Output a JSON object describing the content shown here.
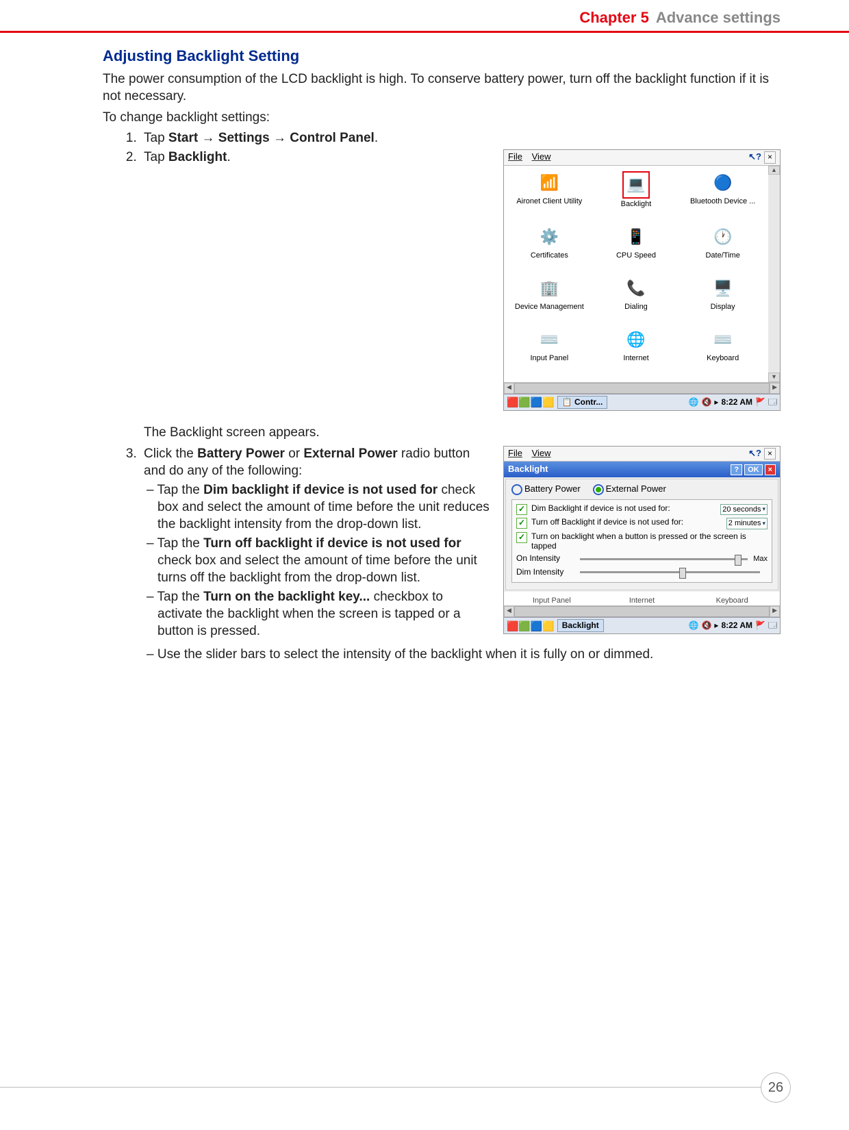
{
  "header": {
    "chapter": "Chapter 5",
    "title": "Advance settings"
  },
  "section_title": "Adjusting Backlight Setting",
  "intro1": "The power consumption of the LCD backlight is high. To conserve battery power, turn off the backlight function if it is not necessary.",
  "intro2": "To change backlight settings:",
  "step1_pre": "Tap ",
  "step1_b1": "Start",
  "step1_b2": "Settings",
  "step1_b3": "Control Panel",
  "arrow": " → ",
  "period": ".",
  "step2_pre": "Tap ",
  "step2_b": "Backlight",
  "appears": "The Backlight screen appears.",
  "step3_pre": "Click the ",
  "step3_b1": "Battery Power",
  "step3_mid": " or ",
  "step3_b2": "External Power",
  "step3_post": " radio button and do any of the fol­lowing:",
  "bul1_pre": "Tap the ",
  "bul1_b": "Dim backlight if device is not used for",
  "bul1_post": " check box and select the amount of time before the unit reduces the backlight intensity from the drop-down list.",
  "bul2_pre": "Tap the ",
  "bul2_b": "Turn off backlight if device is not used for",
  "bul2_post": " check box and select the amount of time before the unit turns off the backlight from the drop-down list.",
  "bul3_pre": "Tap the ",
  "bul3_b": "Turn on the backlight key...",
  "bul3_post": " checkbox to activate the backlight when the screen is tapped or a button is pressed.",
  "bul4": "Use the slider bars to select the intensity of the backlight when it is fully on or dimmed.",
  "ss": {
    "menu_file": "File",
    "menu_view": "View",
    "help": "?",
    "close": "×",
    "cp_items": [
      {
        "label": "Aironet Client Utility",
        "icon": "📶"
      },
      {
        "label": "Backlight",
        "icon": "💻",
        "selected": true
      },
      {
        "label": "Bluetooth Device ...",
        "icon": "🔵"
      },
      {
        "label": "Certificates",
        "icon": "⚙️"
      },
      {
        "label": "CPU Speed",
        "icon": "📱"
      },
      {
        "label": "Date/Time",
        "icon": "🕐"
      },
      {
        "label": "Device Management",
        "icon": "🏢"
      },
      {
        "label": "Dialing",
        "icon": "📞"
      },
      {
        "label": "Display",
        "icon": "🖥️"
      },
      {
        "label": "Input Panel",
        "icon": "⌨️"
      },
      {
        "label": "Internet",
        "icon": "🌐"
      },
      {
        "label": "Keyboard",
        "icon": "⌨️"
      }
    ],
    "task_label1": "Contr...",
    "task_label2": "Backlight",
    "time": "8:22 AM"
  },
  "dlg": {
    "title": "Backlight",
    "ok": "OK",
    "q": "?",
    "x": "×",
    "radio1": "Battery Power",
    "radio2": "External Power",
    "chk1": "Dim Backlight if device is not used for:",
    "dd1": "20 seconds",
    "chk2": "Turn off Backlight if device is not used for:",
    "dd2": "2 minutes",
    "chk3": "Turn on backlight when a button is pressed or the screen is tapped",
    "slider1": "On Intensity",
    "slider2": "Dim Intensity",
    "max": "Max",
    "faded": [
      "Input Panel",
      "Internet",
      "Keyboard"
    ]
  },
  "page_number": "26"
}
